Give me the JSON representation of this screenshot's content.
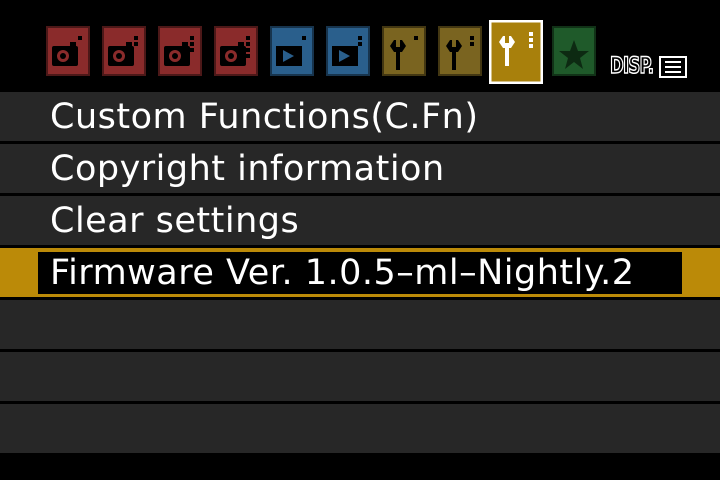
{
  "tabs": [
    {
      "name": "shoot",
      "color": "#8a2b2b",
      "dots": 1,
      "active": false
    },
    {
      "name": "shoot",
      "color": "#8a2b2b",
      "dots": 2,
      "active": false
    },
    {
      "name": "shoot",
      "color": "#8a2b2b",
      "dots": 3,
      "active": false
    },
    {
      "name": "shoot",
      "color": "#8a2b2b",
      "dots": 4,
      "active": false
    },
    {
      "name": "playback",
      "color": "#2a5f8c",
      "dots": 1,
      "active": false
    },
    {
      "name": "playback",
      "color": "#2a5f8c",
      "dots": 2,
      "active": false
    },
    {
      "name": "setup",
      "color": "#7a6420",
      "dots": 1,
      "active": false
    },
    {
      "name": "setup",
      "color": "#7a6420",
      "dots": 2,
      "active": false
    },
    {
      "name": "setup",
      "color": "#a8800c",
      "dots": 3,
      "active": true
    },
    {
      "name": "my-menu",
      "color": "#1f5a2a",
      "dots": 0,
      "active": false
    }
  ],
  "disp": {
    "label": "DISP."
  },
  "menu": {
    "items": [
      {
        "label": "Custom Functions(C.Fn)",
        "selected": false
      },
      {
        "label": "Copyright information",
        "selected": false
      },
      {
        "label": "Clear settings",
        "selected": false
      },
      {
        "label": "Firmware Ver. 1.0.5–ml–Nightly.2",
        "selected": true
      },
      {
        "label": "",
        "selected": false
      },
      {
        "label": "",
        "selected": false
      },
      {
        "label": "",
        "selected": false
      }
    ]
  },
  "colors": {
    "accent": "#bb8a08",
    "row": "#272727",
    "background": "#000000"
  }
}
